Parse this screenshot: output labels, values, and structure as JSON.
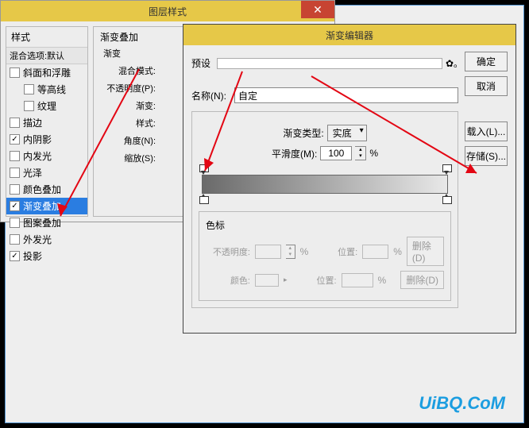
{
  "win1": {
    "title": "图层样式",
    "styles_header": "样式",
    "styles_sub": "混合选项:默认",
    "items": [
      {
        "label": "斜面和浮雕",
        "checked": false,
        "indent": false
      },
      {
        "label": "等高线",
        "checked": false,
        "indent": true
      },
      {
        "label": "纹理",
        "checked": false,
        "indent": true
      },
      {
        "label": "描边",
        "checked": false,
        "indent": false
      },
      {
        "label": "内阴影",
        "checked": true,
        "indent": false
      },
      {
        "label": "内发光",
        "checked": false,
        "indent": false
      },
      {
        "label": "光泽",
        "checked": false,
        "indent": false
      },
      {
        "label": "颜色叠加",
        "checked": false,
        "indent": false
      },
      {
        "label": "渐变叠加",
        "checked": true,
        "indent": false,
        "selected": true
      },
      {
        "label": "图案叠加",
        "checked": false,
        "indent": false
      },
      {
        "label": "外发光",
        "checked": false,
        "indent": false
      },
      {
        "label": "投影",
        "checked": true,
        "indent": false
      }
    ],
    "gradient_section": "渐变叠加",
    "gradient_sub": "渐变",
    "labels": {
      "blend": "混合模式:",
      "opacity": "不透明度(P):",
      "gradient": "渐变:",
      "style": "样式:",
      "angle": "角度(N):",
      "scale": "缩放(S):"
    }
  },
  "win2": {
    "title": "渐变编辑器",
    "preset_label": "预设",
    "buttons": {
      "ok": "确定",
      "cancel": "取消",
      "load": "载入(L)...",
      "save": "存储(S)..."
    },
    "name_label": "名称(N):",
    "name_value": "自定",
    "type_label": "渐变类型:",
    "type_value": "实底",
    "smooth_label": "平滑度(M):",
    "smooth_value": "100",
    "percent": "%",
    "swatch_header": "色标",
    "opacity_label": "不透明度:",
    "position_label": "位置:",
    "color_label": "颜色:",
    "delete_label": "删除(D)"
  },
  "watermark": "UiBQ.CoM"
}
